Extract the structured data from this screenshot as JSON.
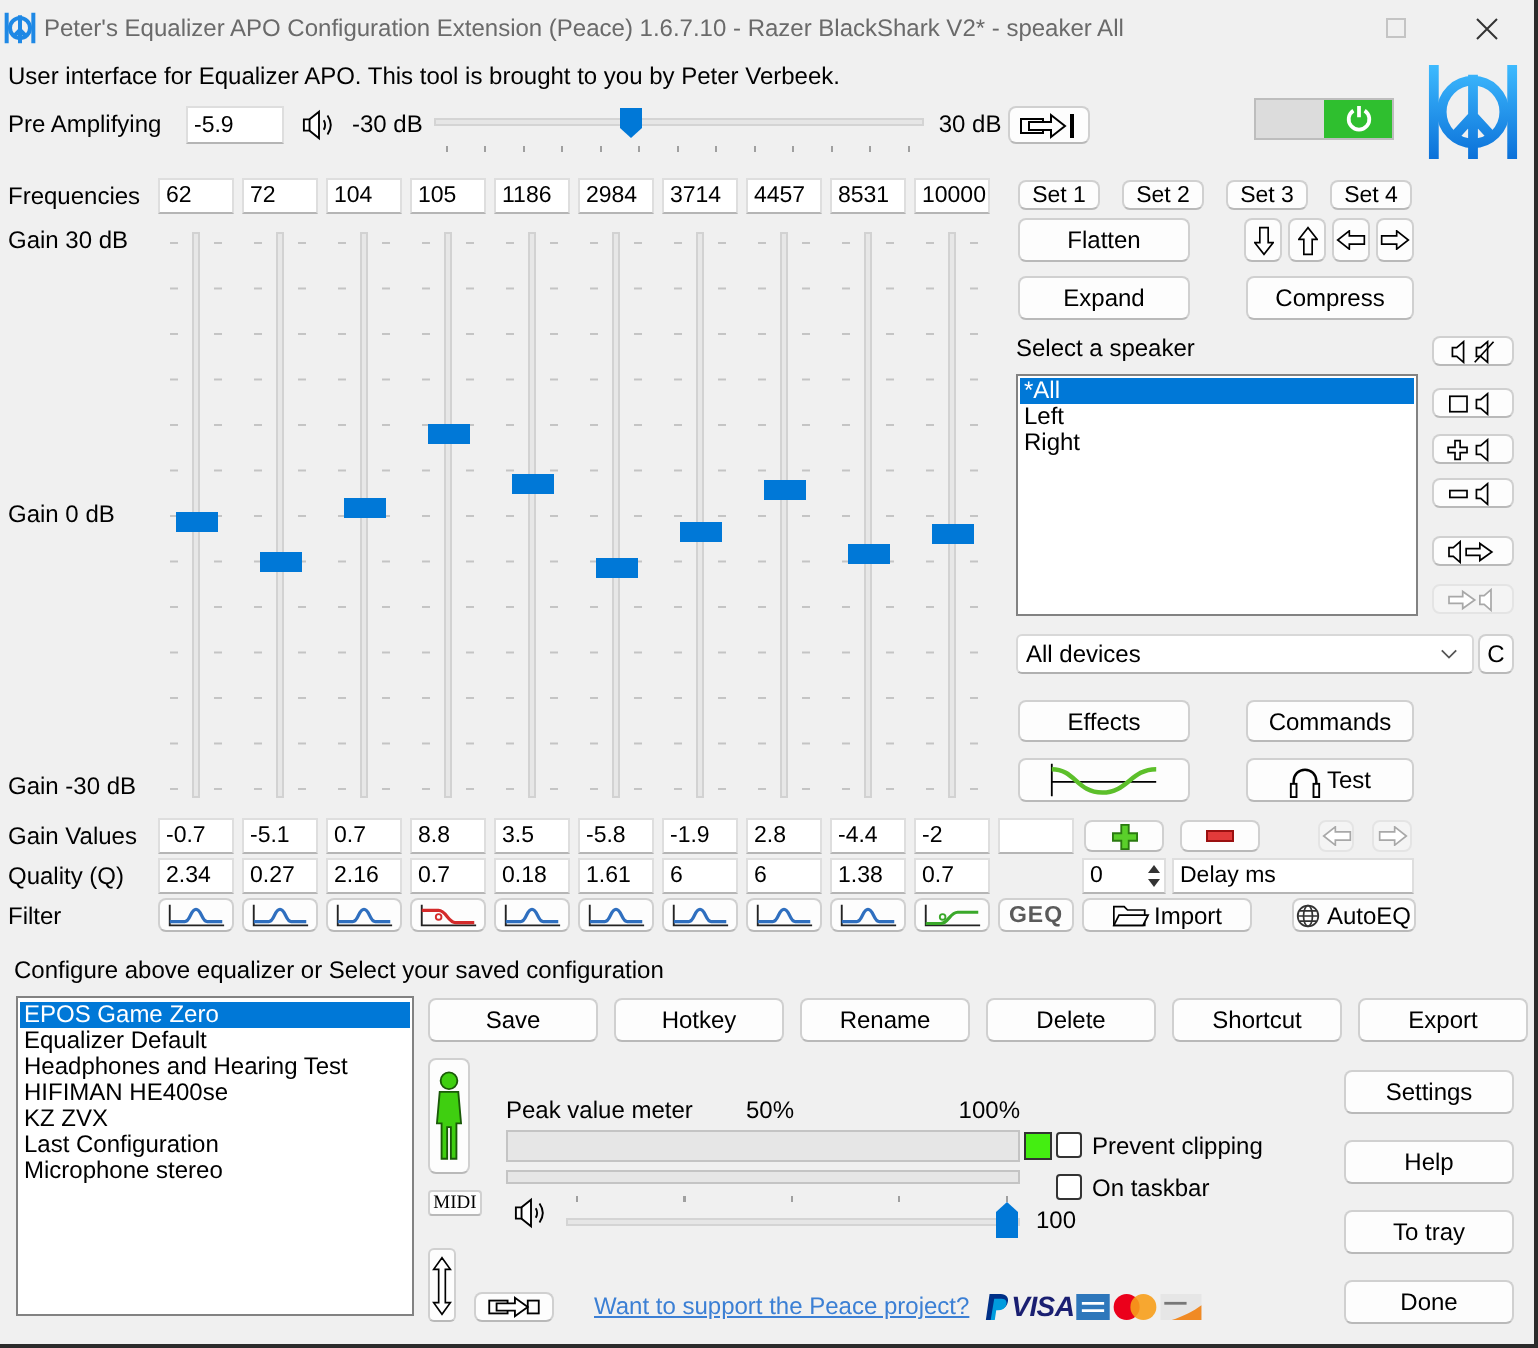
{
  "window": {
    "title": "Peter's Equalizer APO Configuration Extension (Peace) 1.6.7.10 - Razer BlackShark V2* - speaker All"
  },
  "intro": "User interface for Equalizer APO. This tool is brought to you by Peter Verbeek.",
  "pre_amp": {
    "label": "Pre Amplifying",
    "value": "-5.9",
    "min_label": "-30 dB",
    "max_label": "30 dB",
    "level": 0.4
  },
  "power": {
    "on": true
  },
  "equalizer": {
    "frequency_label": "Frequencies",
    "gain_scale": [
      "Gain 30 dB",
      "Gain 0 dB",
      "Gain -30 dB"
    ],
    "gain_label": "Gain Values",
    "quality_label": "Quality (Q)",
    "filter_label": "Filter",
    "bands": [
      {
        "frequency": "62",
        "gain": "-0.7",
        "quality": "2.34",
        "level": 0.488,
        "filter": {
          "kind": "peak"
        }
      },
      {
        "frequency": "72",
        "gain": "-5.1",
        "quality": "0.27",
        "level": 0.415,
        "filter": {
          "kind": "peak"
        }
      },
      {
        "frequency": "104",
        "gain": "0.7",
        "quality": "2.16",
        "level": 0.512,
        "filter": {
          "kind": "peak"
        }
      },
      {
        "frequency": "105",
        "gain": "8.8",
        "quality": "0.7",
        "level": 0.647,
        "filter": {
          "kind": "lowpass"
        }
      },
      {
        "frequency": "1186",
        "gain": "3.5",
        "quality": "0.18",
        "level": 0.558,
        "filter": {
          "kind": "peak"
        }
      },
      {
        "frequency": "2984",
        "gain": "-5.8",
        "quality": "1.61",
        "level": 0.403,
        "filter": {
          "kind": "peak"
        }
      },
      {
        "frequency": "3714",
        "gain": "-1.9",
        "quality": "6",
        "level": 0.468,
        "filter": {
          "kind": "peak"
        }
      },
      {
        "frequency": "4457",
        "gain": "2.8",
        "quality": "6",
        "level": 0.547,
        "filter": {
          "kind": "peak"
        }
      },
      {
        "frequency": "8531",
        "gain": "-4.4",
        "quality": "1.38",
        "level": 0.427,
        "filter": {
          "kind": "peak"
        }
      },
      {
        "frequency": "10000",
        "gain": "-2",
        "quality": "0.7",
        "level": 0.467,
        "filter": {
          "kind": "shelf"
        }
      }
    ]
  },
  "sets": [
    "Set 1",
    "Set 2",
    "Set 3",
    "Set 4"
  ],
  "shape_buttons": {
    "flatten": "Flatten",
    "expand": "Expand",
    "compress": "Compress"
  },
  "shift_buttons": [
    {
      "kind": "down"
    },
    {
      "kind": "up"
    },
    {
      "kind": "left"
    },
    {
      "kind": "right"
    }
  ],
  "speakers": {
    "label": "Select a speaker",
    "items": [
      {
        "name": "*All",
        "selected": true
      },
      {
        "name": "Left",
        "selected": false
      },
      {
        "name": "Right",
        "selected": false
      }
    ],
    "tools": [
      {
        "kind": "mute",
        "disabled": false
      },
      {
        "kind": "blank",
        "disabled": false
      },
      {
        "kind": "add",
        "disabled": false
      },
      {
        "kind": "remove",
        "disabled": false
      },
      {
        "kind": "out",
        "disabled": false
      },
      {
        "kind": "in",
        "disabled": true
      }
    ]
  },
  "device": {
    "value": "All devices",
    "button": "C"
  },
  "actions": {
    "effects": "Effects",
    "commands": "Commands",
    "test": "Test"
  },
  "band_tools": [
    {
      "kind": "add",
      "disabled": false
    },
    {
      "kind": "remove",
      "disabled": false
    },
    {
      "kind": "left",
      "disabled": true
    },
    {
      "kind": "right",
      "disabled": true
    }
  ],
  "delay": {
    "value": "0",
    "label": "Delay ms"
  },
  "filter_tools": {
    "geq": "GEQ",
    "import": "Import",
    "autoeq": "AutoEQ"
  },
  "configurations": {
    "prompt": "Configure above equalizer or Select your saved configuration",
    "items": [
      {
        "name": "EPOS Game Zero",
        "selected": true
      },
      {
        "name": "Equalizer Default",
        "selected": false
      },
      {
        "name": "Headphones and Hearing Test",
        "selected": false
      },
      {
        "name": "HIFIMAN HE400se",
        "selected": false
      },
      {
        "name": "KZ ZVX",
        "selected": false
      },
      {
        "name": "Last Configuration",
        "selected": false
      },
      {
        "name": "Microphone stereo",
        "selected": false
      }
    ]
  },
  "config_buttons": [
    "Save",
    "Hotkey",
    "Rename",
    "Delete",
    "Shortcut",
    "Export"
  ],
  "midi": "MIDI",
  "peak_meter": {
    "label": "Peak value meter",
    "mid_label": "50%",
    "max_label": "100%",
    "clipping": false
  },
  "options": [
    {
      "label": "Prevent clipping",
      "checked": false
    },
    {
      "label": "On taskbar",
      "checked": false
    }
  ],
  "volume": {
    "level": 1,
    "reading": "100"
  },
  "support_link": "Want to support the Peace project?",
  "payment": [
    {
      "kind": "paypal"
    },
    {
      "kind": "visa",
      "label": "VISA"
    },
    {
      "kind": "amex"
    },
    {
      "kind": "mastercard"
    },
    {
      "kind": "discover"
    }
  ],
  "side_buttons": [
    "Settings",
    "Help",
    "To tray",
    "Done"
  ]
}
